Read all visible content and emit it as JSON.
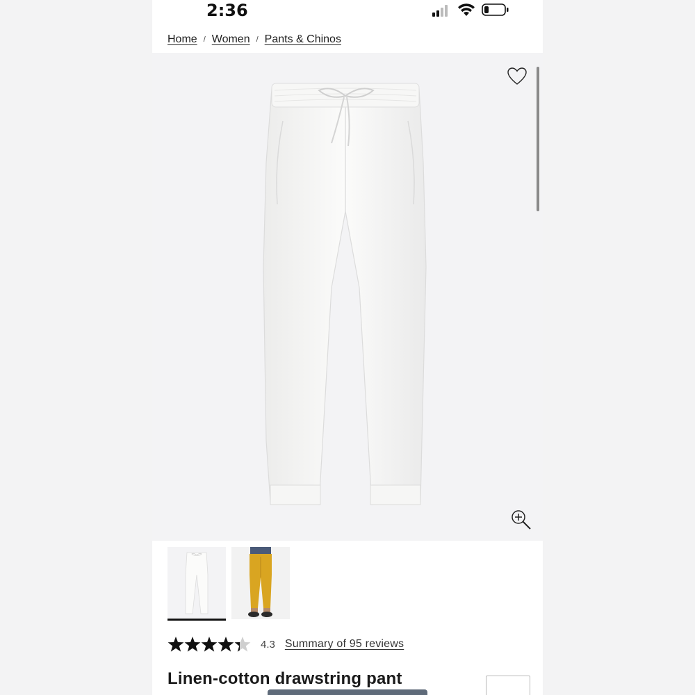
{
  "status": {
    "time": "2:36",
    "signal_icon": "cellular-signal-icon",
    "wifi_icon": "wifi-icon",
    "battery_icon": "battery-icon"
  },
  "breadcrumb": {
    "items": [
      "Home",
      "Women",
      "Pants & Chinos"
    ],
    "separator": "/"
  },
  "hero": {
    "favorite_icon": "heart-icon",
    "zoom_icon": "zoom-in-icon"
  },
  "thumbnails": [
    {
      "name": "white-pant-front",
      "selected": true
    },
    {
      "name": "yellow-pant-model",
      "selected": false
    }
  ],
  "rating": {
    "value": "4.3",
    "stars": 4.3,
    "reviews_link": "Summary of 95 reviews"
  },
  "product": {
    "title": "Linen-cotton drawstring pant"
  },
  "colors": {
    "link": "#333333",
    "hero_bg": "#f3f3f5",
    "thumb_yellow": "#d9a521"
  }
}
